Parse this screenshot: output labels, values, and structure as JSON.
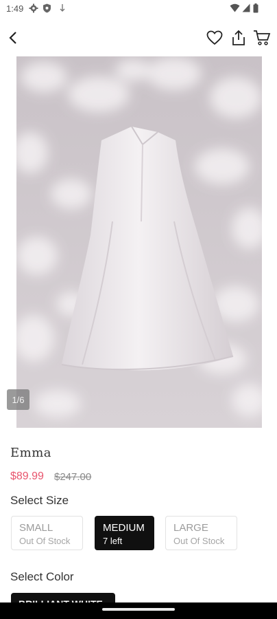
{
  "status_bar": {
    "time": "1:49"
  },
  "product": {
    "image_counter": "1/6",
    "name": "Emma",
    "sale_price": "$89.99",
    "original_price": "$247.00"
  },
  "size_section": {
    "heading": "Select Size",
    "options": [
      {
        "name": "SMALL",
        "status": "Out Of Stock",
        "selected": false
      },
      {
        "name": "MEDIUM",
        "status": "7 left",
        "selected": true
      },
      {
        "name": "LARGE",
        "status": "Out Of Stock",
        "selected": false
      }
    ]
  },
  "color_section": {
    "heading": "Select Color",
    "options": [
      {
        "name": "BRILLIANT WHITE",
        "selected": true
      }
    ]
  },
  "colors": {
    "sale_price": "#e8556d",
    "selected_option": "#101010"
  },
  "icons": {
    "status": [
      "gear-icon",
      "shield-icon",
      "download-icon",
      "wifi-icon",
      "signal-icon",
      "battery-icon"
    ],
    "header": [
      "back-arrow-icon",
      "heart-icon",
      "share-icon",
      "cart-icon"
    ]
  }
}
